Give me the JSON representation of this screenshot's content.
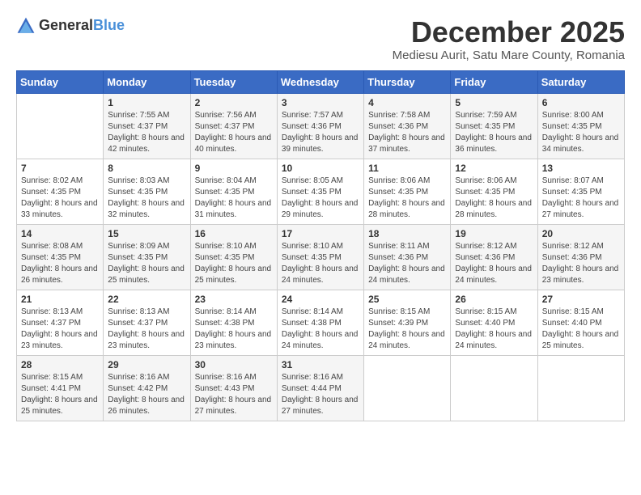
{
  "header": {
    "logo_general": "General",
    "logo_blue": "Blue",
    "title": "December 2025",
    "subtitle": "Mediesu Aurit, Satu Mare County, Romania"
  },
  "days_of_week": [
    "Sunday",
    "Monday",
    "Tuesday",
    "Wednesday",
    "Thursday",
    "Friday",
    "Saturday"
  ],
  "weeks": [
    [
      {
        "day": "",
        "sunrise": "",
        "sunset": "",
        "daylight": ""
      },
      {
        "day": "1",
        "sunrise": "Sunrise: 7:55 AM",
        "sunset": "Sunset: 4:37 PM",
        "daylight": "Daylight: 8 hours and 42 minutes."
      },
      {
        "day": "2",
        "sunrise": "Sunrise: 7:56 AM",
        "sunset": "Sunset: 4:37 PM",
        "daylight": "Daylight: 8 hours and 40 minutes."
      },
      {
        "day": "3",
        "sunrise": "Sunrise: 7:57 AM",
        "sunset": "Sunset: 4:36 PM",
        "daylight": "Daylight: 8 hours and 39 minutes."
      },
      {
        "day": "4",
        "sunrise": "Sunrise: 7:58 AM",
        "sunset": "Sunset: 4:36 PM",
        "daylight": "Daylight: 8 hours and 37 minutes."
      },
      {
        "day": "5",
        "sunrise": "Sunrise: 7:59 AM",
        "sunset": "Sunset: 4:35 PM",
        "daylight": "Daylight: 8 hours and 36 minutes."
      },
      {
        "day": "6",
        "sunrise": "Sunrise: 8:00 AM",
        "sunset": "Sunset: 4:35 PM",
        "daylight": "Daylight: 8 hours and 34 minutes."
      }
    ],
    [
      {
        "day": "7",
        "sunrise": "Sunrise: 8:02 AM",
        "sunset": "Sunset: 4:35 PM",
        "daylight": "Daylight: 8 hours and 33 minutes."
      },
      {
        "day": "8",
        "sunrise": "Sunrise: 8:03 AM",
        "sunset": "Sunset: 4:35 PM",
        "daylight": "Daylight: 8 hours and 32 minutes."
      },
      {
        "day": "9",
        "sunrise": "Sunrise: 8:04 AM",
        "sunset": "Sunset: 4:35 PM",
        "daylight": "Daylight: 8 hours and 31 minutes."
      },
      {
        "day": "10",
        "sunrise": "Sunrise: 8:05 AM",
        "sunset": "Sunset: 4:35 PM",
        "daylight": "Daylight: 8 hours and 29 minutes."
      },
      {
        "day": "11",
        "sunrise": "Sunrise: 8:06 AM",
        "sunset": "Sunset: 4:35 PM",
        "daylight": "Daylight: 8 hours and 28 minutes."
      },
      {
        "day": "12",
        "sunrise": "Sunrise: 8:06 AM",
        "sunset": "Sunset: 4:35 PM",
        "daylight": "Daylight: 8 hours and 28 minutes."
      },
      {
        "day": "13",
        "sunrise": "Sunrise: 8:07 AM",
        "sunset": "Sunset: 4:35 PM",
        "daylight": "Daylight: 8 hours and 27 minutes."
      }
    ],
    [
      {
        "day": "14",
        "sunrise": "Sunrise: 8:08 AM",
        "sunset": "Sunset: 4:35 PM",
        "daylight": "Daylight: 8 hours and 26 minutes."
      },
      {
        "day": "15",
        "sunrise": "Sunrise: 8:09 AM",
        "sunset": "Sunset: 4:35 PM",
        "daylight": "Daylight: 8 hours and 25 minutes."
      },
      {
        "day": "16",
        "sunrise": "Sunrise: 8:10 AM",
        "sunset": "Sunset: 4:35 PM",
        "daylight": "Daylight: 8 hours and 25 minutes."
      },
      {
        "day": "17",
        "sunrise": "Sunrise: 8:10 AM",
        "sunset": "Sunset: 4:35 PM",
        "daylight": "Daylight: 8 hours and 24 minutes."
      },
      {
        "day": "18",
        "sunrise": "Sunrise: 8:11 AM",
        "sunset": "Sunset: 4:36 PM",
        "daylight": "Daylight: 8 hours and 24 minutes."
      },
      {
        "day": "19",
        "sunrise": "Sunrise: 8:12 AM",
        "sunset": "Sunset: 4:36 PM",
        "daylight": "Daylight: 8 hours and 24 minutes."
      },
      {
        "day": "20",
        "sunrise": "Sunrise: 8:12 AM",
        "sunset": "Sunset: 4:36 PM",
        "daylight": "Daylight: 8 hours and 23 minutes."
      }
    ],
    [
      {
        "day": "21",
        "sunrise": "Sunrise: 8:13 AM",
        "sunset": "Sunset: 4:37 PM",
        "daylight": "Daylight: 8 hours and 23 minutes."
      },
      {
        "day": "22",
        "sunrise": "Sunrise: 8:13 AM",
        "sunset": "Sunset: 4:37 PM",
        "daylight": "Daylight: 8 hours and 23 minutes."
      },
      {
        "day": "23",
        "sunrise": "Sunrise: 8:14 AM",
        "sunset": "Sunset: 4:38 PM",
        "daylight": "Daylight: 8 hours and 23 minutes."
      },
      {
        "day": "24",
        "sunrise": "Sunrise: 8:14 AM",
        "sunset": "Sunset: 4:38 PM",
        "daylight": "Daylight: 8 hours and 24 minutes."
      },
      {
        "day": "25",
        "sunrise": "Sunrise: 8:15 AM",
        "sunset": "Sunset: 4:39 PM",
        "daylight": "Daylight: 8 hours and 24 minutes."
      },
      {
        "day": "26",
        "sunrise": "Sunrise: 8:15 AM",
        "sunset": "Sunset: 4:40 PM",
        "daylight": "Daylight: 8 hours and 24 minutes."
      },
      {
        "day": "27",
        "sunrise": "Sunrise: 8:15 AM",
        "sunset": "Sunset: 4:40 PM",
        "daylight": "Daylight: 8 hours and 25 minutes."
      }
    ],
    [
      {
        "day": "28",
        "sunrise": "Sunrise: 8:15 AM",
        "sunset": "Sunset: 4:41 PM",
        "daylight": "Daylight: 8 hours and 25 minutes."
      },
      {
        "day": "29",
        "sunrise": "Sunrise: 8:16 AM",
        "sunset": "Sunset: 4:42 PM",
        "daylight": "Daylight: 8 hours and 26 minutes."
      },
      {
        "day": "30",
        "sunrise": "Sunrise: 8:16 AM",
        "sunset": "Sunset: 4:43 PM",
        "daylight": "Daylight: 8 hours and 27 minutes."
      },
      {
        "day": "31",
        "sunrise": "Sunrise: 8:16 AM",
        "sunset": "Sunset: 4:44 PM",
        "daylight": "Daylight: 8 hours and 27 minutes."
      },
      {
        "day": "",
        "sunrise": "",
        "sunset": "",
        "daylight": ""
      },
      {
        "day": "",
        "sunrise": "",
        "sunset": "",
        "daylight": ""
      },
      {
        "day": "",
        "sunrise": "",
        "sunset": "",
        "daylight": ""
      }
    ]
  ]
}
